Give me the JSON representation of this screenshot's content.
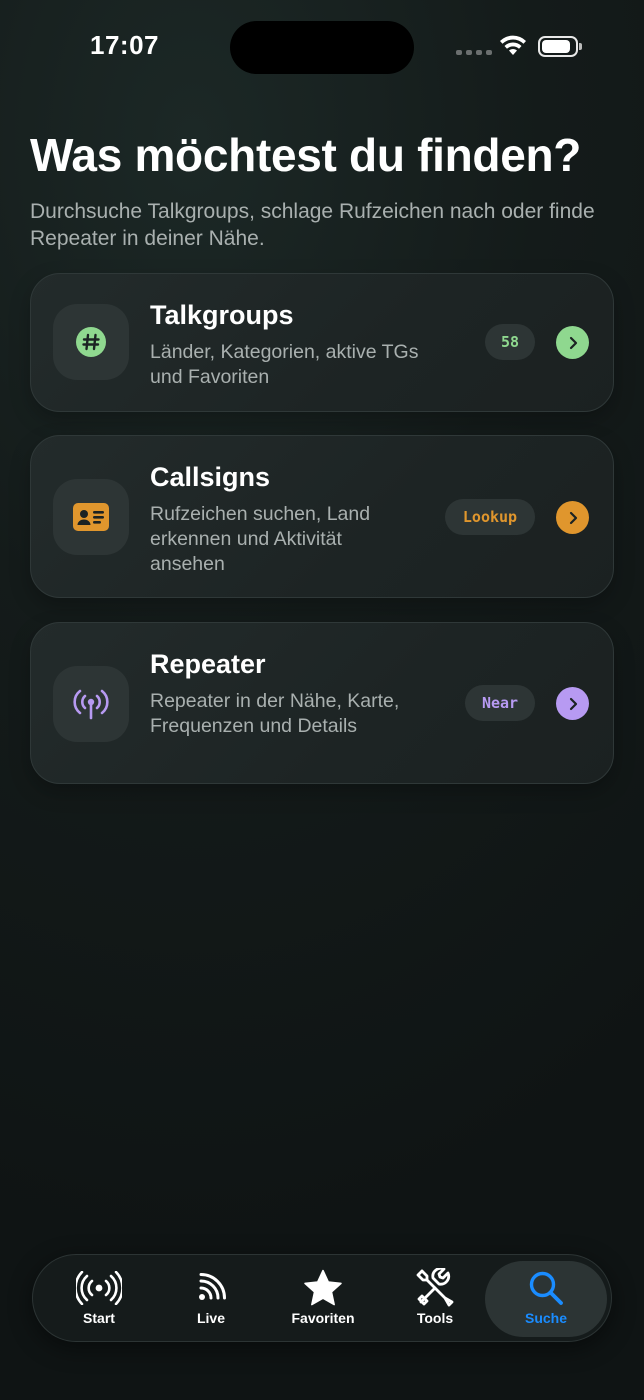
{
  "status_bar": {
    "time": "17:07",
    "battery_level": 0.9
  },
  "header": {
    "title": "Was möchtest du finden?",
    "subtitle": "Durchsuche Talkgroups, schlage Rufzeichen nach oder finde Repeater in deiner Nähe."
  },
  "cards": [
    {
      "title": "Talkgroups",
      "description": "Länder, Kategorien, aktive TGs und Favoriten",
      "badge": "58",
      "icon": "hashtag-icon",
      "accent": "#8fd88f"
    },
    {
      "title": "Callsigns",
      "description": "Rufzeichen suchen, Land erkennen und Aktivität ansehen",
      "badge": "Lookup",
      "icon": "id-card-icon",
      "accent": "#e0962d"
    },
    {
      "title": "Repeater",
      "description": "Repeater in der Nähe, Karte, Frequenzen und Details",
      "badge": "Near",
      "icon": "antenna-icon",
      "accent": "#b79af2"
    }
  ],
  "tab_bar": {
    "active_color": "#1a8cff",
    "items": [
      {
        "label": "Start",
        "icon": "broadcast-icon"
      },
      {
        "label": "Live",
        "icon": "rss-icon"
      },
      {
        "label": "Favoriten",
        "icon": "star-icon"
      },
      {
        "label": "Tools",
        "icon": "tools-icon"
      },
      {
        "label": "Suche",
        "icon": "search-icon",
        "active": true
      }
    ]
  }
}
